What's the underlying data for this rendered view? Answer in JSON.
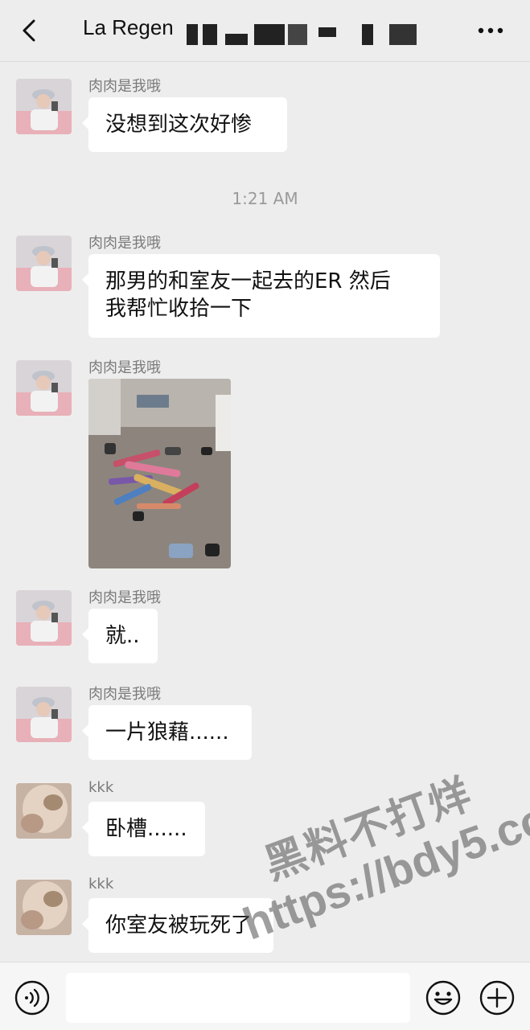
{
  "header": {
    "title": "La Regen",
    "back_icon": "chevron-left-icon",
    "more_icon": "more-dots-icon"
  },
  "messages": [
    {
      "sender": "肉肉是我哦",
      "text": "没想到这次好惨"
    },
    {
      "timestamp": "1:21 AM"
    },
    {
      "sender": "肉肉是我哦",
      "lines": [
        "那男的和室友一起去的ER 然后",
        "我帮忙收拾一下"
      ]
    },
    {
      "sender": "肉肉是我哦",
      "image": "room-floor-photo"
    },
    {
      "sender": "肉肉是我哦",
      "text": "就.."
    },
    {
      "sender": "肉肉是我哦",
      "text": "一片狼藉......"
    },
    {
      "sender": "kkk",
      "text": "卧槽......"
    },
    {
      "sender": "kkk",
      "text": "你室友被玩死了"
    }
  ],
  "input_bar": {
    "voice_icon": "voice-icon",
    "emoji_icon": "emoji-icon",
    "plus_icon": "plus-icon"
  },
  "watermark": {
    "line1": "黑料不打烊",
    "line2": "https://bdy5.co"
  },
  "colors": {
    "background": "#ededed",
    "bubble": "#ffffff",
    "sender_text": "#7a7a7a"
  }
}
